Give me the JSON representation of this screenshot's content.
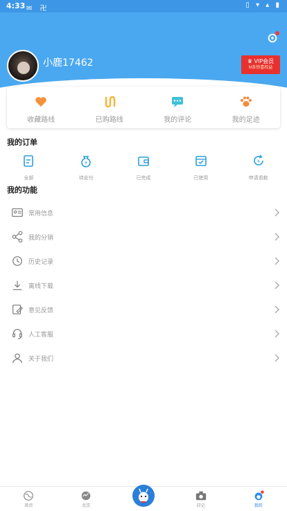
{
  "status_bar": {
    "time": "4:33",
    "left_icons": "✉ 卍",
    "right_icons": "▯ ▾ ▴ ▮"
  },
  "header": {
    "username": "小鹿17462",
    "vip_line1": "♛ VIP会员",
    "vip_line2": "N条惊喜权益"
  },
  "route_actions": [
    {
      "label": "收藏路线",
      "icon": "heart-icon",
      "color": "#f5913a"
    },
    {
      "label": "已购路线",
      "icon": "route-icon",
      "color": "#f5b53a"
    },
    {
      "label": "我的评论",
      "icon": "comment-icon",
      "color": "#3fc0d9"
    },
    {
      "label": "我的足迹",
      "icon": "paw-icon",
      "color": "#f58a3a"
    }
  ],
  "orders": {
    "title": "我的订单",
    "items": [
      {
        "label": "全部",
        "icon": "clipboard-icon"
      },
      {
        "label": "待支付",
        "icon": "money-bag-icon"
      },
      {
        "label": "已完成",
        "icon": "wallet-icon"
      },
      {
        "label": "已使用",
        "icon": "envelope-check-icon"
      },
      {
        "label": "申请退款",
        "icon": "refund-icon"
      }
    ]
  },
  "functions": {
    "title": "我的功能",
    "items": [
      {
        "label": "常用信息",
        "icon": "id-card-icon"
      },
      {
        "label": "我的分销",
        "icon": "share-icon"
      },
      {
        "label": "历史记录",
        "icon": "clock-icon"
      },
      {
        "label": "离线下载",
        "icon": "download-icon"
      },
      {
        "label": "意见反馈",
        "icon": "feedback-icon"
      },
      {
        "label": "人工客服",
        "icon": "headset-icon"
      },
      {
        "label": "关于我们",
        "icon": "user-icon"
      }
    ]
  },
  "tabbar": {
    "items": [
      {
        "label": "首页",
        "icon": "home-globe-icon"
      },
      {
        "label": "北京",
        "icon": "city-globe-icon"
      },
      {
        "label": "",
        "icon": "deer-mascot-icon"
      },
      {
        "label": "印记",
        "icon": "camera-icon"
      },
      {
        "label": "我的",
        "icon": "profile-deer-icon",
        "active": true
      }
    ]
  },
  "colors": {
    "primary": "#4aa8f0",
    "vip": "#e8312f",
    "accent_blue": "#2a8de8"
  }
}
